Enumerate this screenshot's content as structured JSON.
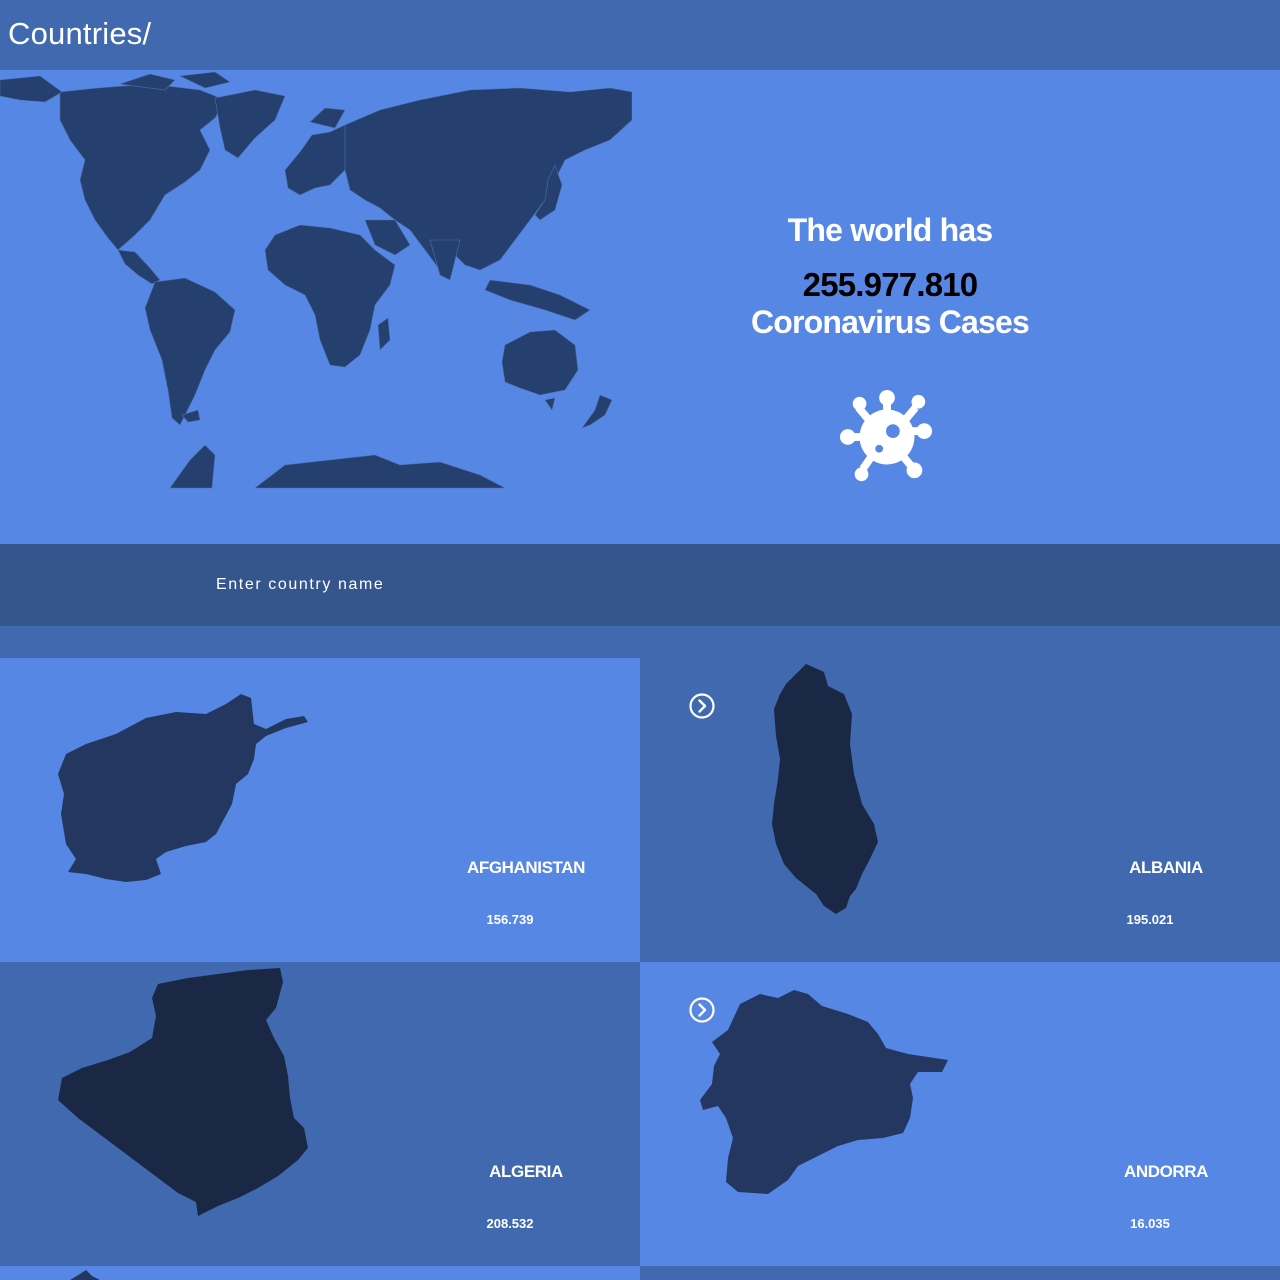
{
  "header": {
    "title": "Countries/"
  },
  "hero": {
    "line1": "The world has",
    "total_cases": "255.977.810",
    "line2": "Coronavirus Cases",
    "map_icon": "world-map",
    "virus_icon": "virus-icon"
  },
  "search": {
    "placeholder": "Enter country name",
    "value": ""
  },
  "countries": [
    {
      "name": "AFGHANISTAN",
      "cases": "156.739"
    },
    {
      "name": "ALBANIA",
      "cases": "195.021"
    },
    {
      "name": "ALGERIA",
      "cases": "208.532"
    },
    {
      "name": "ANDORRA",
      "cases": "16.035"
    }
  ],
  "colors": {
    "header_bg": "#4169b0",
    "hero_bg": "#5787e4",
    "search_bg": "#34568c",
    "map_fill": "#253f6e",
    "country_fill": "#1a2845"
  }
}
